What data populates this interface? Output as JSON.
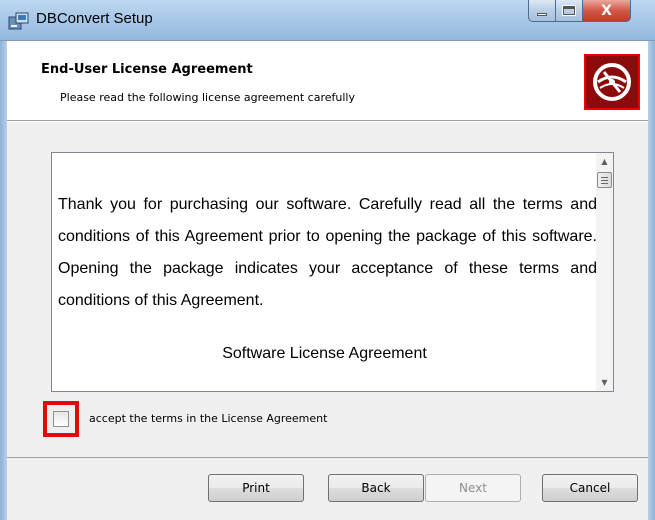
{
  "window": {
    "title": "DBConvert Setup",
    "caption_buttons": {
      "minimize_icon": "minimize-icon",
      "maximize_icon": "maximize-icon",
      "close_label": "X"
    }
  },
  "header": {
    "title": "End-User License Agreement",
    "subtitle": "Please read the following license agreement carefully",
    "logo_icon": "dbconvert-logo-icon"
  },
  "license": {
    "paragraph": "Thank you for purchasing our software. Carefully read all the terms and conditions of this Agreement prior to opening the package of this software. Opening the package indicates your acceptance of these terms and conditions of this Agreement.",
    "heading": "Software License Agreement"
  },
  "accept": {
    "label": "accept the terms in the License Agreement",
    "checked": false
  },
  "buttons": {
    "print": "Print",
    "back": "Back",
    "next": "Next",
    "cancel": "Cancel"
  },
  "colors": {
    "highlight": "#e00b0b",
    "logo_bg": "#8b0a0a",
    "titlebar": "#a9c9e8"
  }
}
